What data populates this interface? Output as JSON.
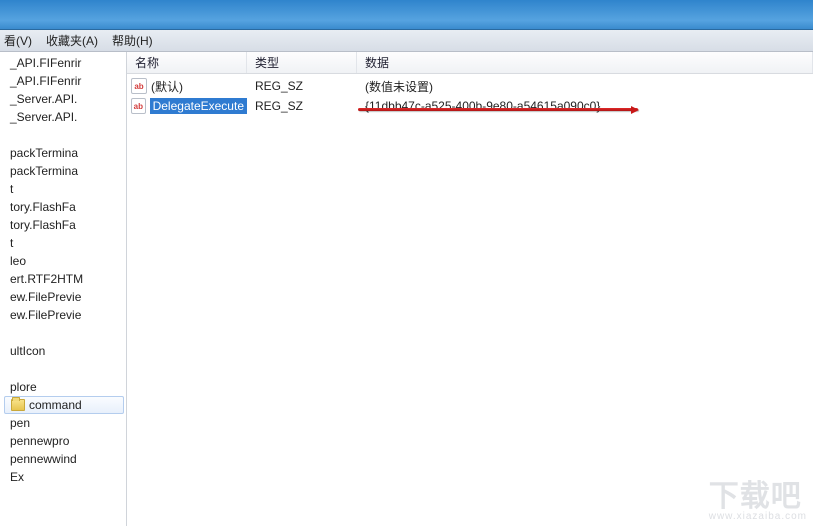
{
  "menu": {
    "view": "看(V)",
    "favorites": "收藏夹(A)",
    "help": "帮助(H)"
  },
  "tree": {
    "items": [
      "_API.FIFenrir",
      "_API.FIFenrir",
      "_Server.API.",
      "_Server.API.",
      "",
      "packTermina",
      "packTermina",
      "t",
      "tory.FlashFa",
      "tory.FlashFa",
      "t",
      "leo",
      "ert.RTF2HTM",
      "ew.FilePrevie",
      "ew.FilePrevie",
      "",
      "ultIcon",
      "",
      "plore",
      "command",
      "pen",
      "pennewpro",
      "pennewwind",
      "Ex"
    ],
    "folder_index": 19
  },
  "columns": {
    "name": "名称",
    "type": "类型",
    "data": "数据"
  },
  "rows": [
    {
      "name": "(默认)",
      "type": "REG_SZ",
      "data": "(数值未设置)",
      "selected": false
    },
    {
      "name": "DelegateExecute",
      "type": "REG_SZ",
      "data": "{11dbb47c-a525-400b-9e80-a54615a090c0}",
      "selected": true
    }
  ],
  "watermark": {
    "big": "下载吧",
    "small": "www.xiazaiba.com"
  }
}
